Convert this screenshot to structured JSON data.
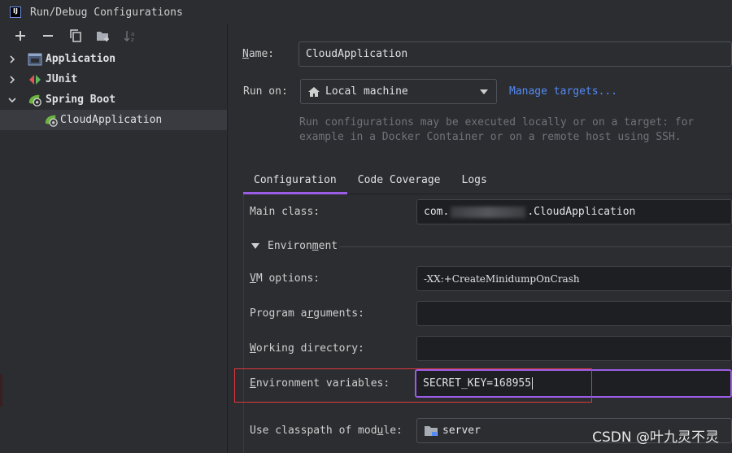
{
  "window": {
    "title": "Run/Debug Configurations",
    "logo_text": "IJ"
  },
  "toolbar": {
    "icons": [
      "add-icon",
      "remove-icon",
      "copy-icon",
      "new-folder-icon",
      "sort-icon"
    ]
  },
  "tree": {
    "items": [
      {
        "label": "Application",
        "expanded": false,
        "icon": "application-icon"
      },
      {
        "label": "JUnit",
        "expanded": false,
        "icon": "junit-icon"
      },
      {
        "label": "Spring Boot",
        "expanded": true,
        "icon": "spring-boot-icon"
      }
    ],
    "child": {
      "label": "CloudApplication",
      "icon": "spring-boot-icon"
    }
  },
  "form": {
    "name_label": "Name:",
    "name_value": "CloudApplication",
    "run_on_label": "Run on:",
    "run_on_value": "Local machine",
    "manage_targets": "Manage targets...",
    "hint_line1": "Run configurations may be executed locally or on a target: for",
    "hint_line2": "example in a Docker Container or on a remote host using SSH."
  },
  "tabs": [
    {
      "label": "Configuration",
      "active": true
    },
    {
      "label": "Code Coverage",
      "active": false
    },
    {
      "label": "Logs",
      "active": false
    }
  ],
  "config": {
    "main_class_label": "Main class:",
    "main_class_prefix": "com.",
    "main_class_suffix": ".CloudApplication",
    "environment_label": "Environment",
    "vm_options_label": "VM options:",
    "vm_options_value": "-XX:+CreateMinidumpOnCrash",
    "program_args_label": "Program arguments:",
    "program_args_value": "",
    "working_dir_label": "Working directory:",
    "working_dir_value": "",
    "env_vars_label": "Environment variables:",
    "env_vars_value": "SECRET_KEY=168955",
    "classpath_label": "Use classpath of module:",
    "classpath_value": "server"
  },
  "watermark": "CSDN @叶九灵不灵",
  "colors": {
    "accent": "#9b5de5",
    "link": "#548af7",
    "highlight": "#e0383e",
    "spring": "#6db33f"
  }
}
